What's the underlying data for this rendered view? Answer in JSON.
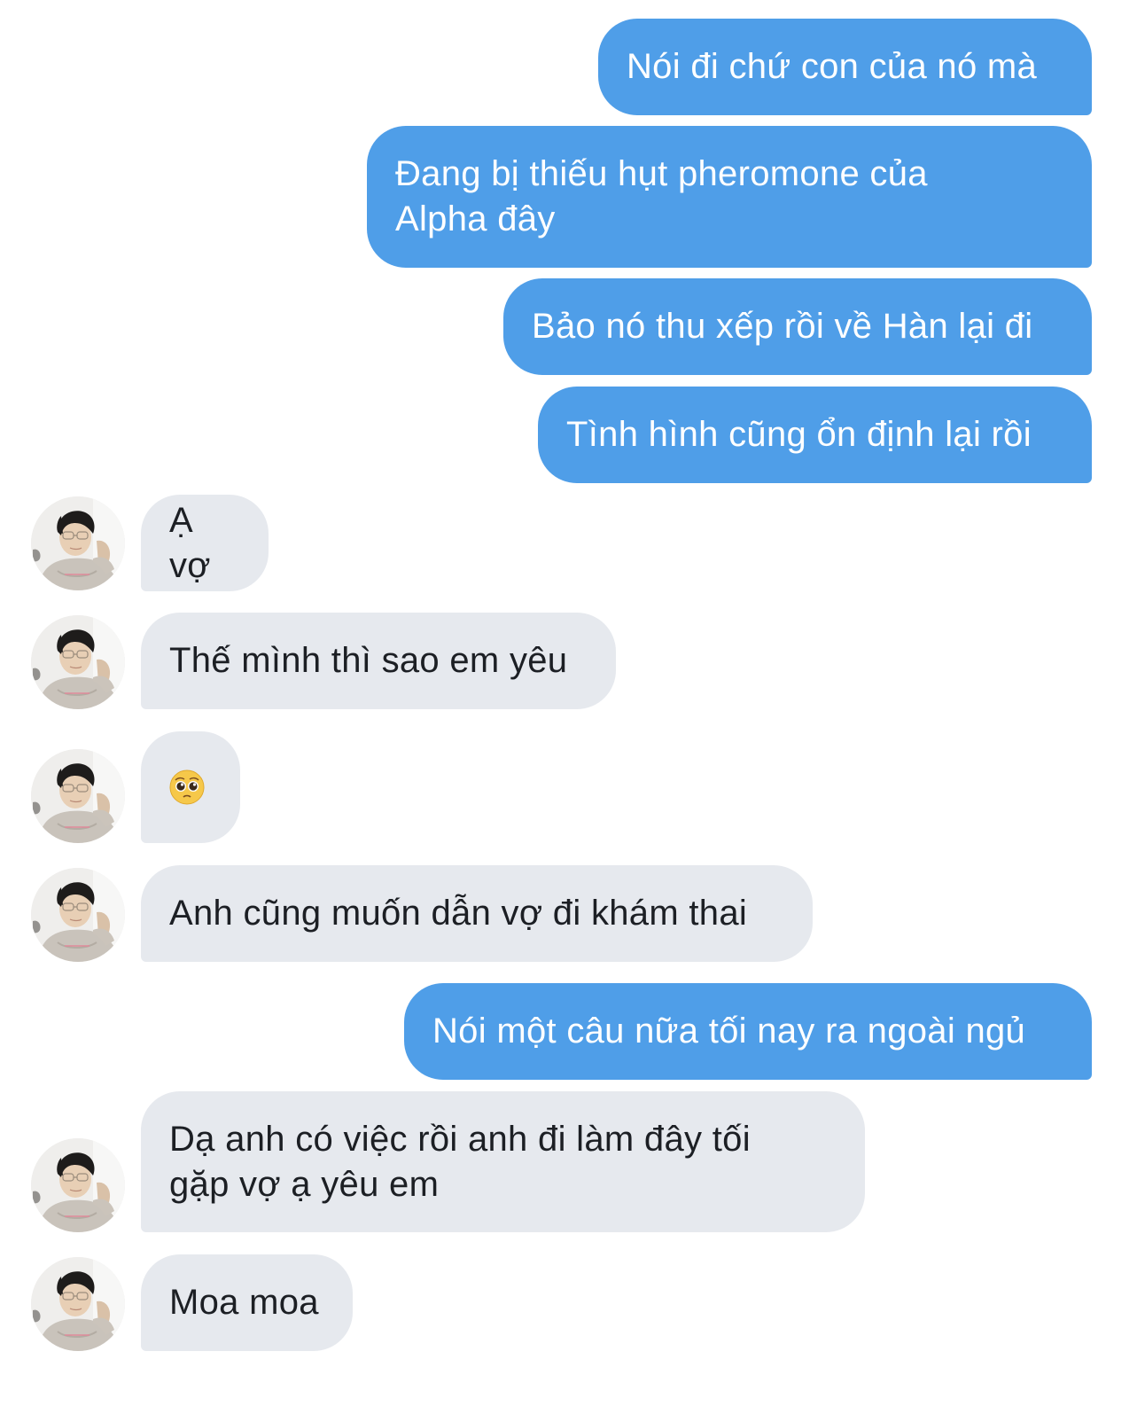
{
  "messages": [
    {
      "id": 1,
      "direction": "outgoing",
      "text": "Nói đi chứ con của nó mà"
    },
    {
      "id": 2,
      "direction": "outgoing",
      "text": "Đang bị thiếu hụt pheromone của Alpha đây"
    },
    {
      "id": 3,
      "direction": "outgoing",
      "text": "Bảo nó thu xếp rồi về Hàn lại đi"
    },
    {
      "id": 4,
      "direction": "outgoing",
      "text": "Tình hình cũng ổn định lại rồi"
    },
    {
      "id": 5,
      "direction": "incoming",
      "text": "Ạ vợ"
    },
    {
      "id": 6,
      "direction": "incoming",
      "text": "Thế mình thì sao em yêu"
    },
    {
      "id": 7,
      "direction": "incoming",
      "text": "",
      "emoji": "pleading-face"
    },
    {
      "id": 8,
      "direction": "incoming",
      "text": "Anh cũng muốn dẫn vợ đi khám thai"
    },
    {
      "id": 9,
      "direction": "outgoing",
      "text": "Nói một câu nữa tối nay ra ngoài ngủ"
    },
    {
      "id": 10,
      "direction": "incoming",
      "text": "Dạ anh có việc rồi anh đi làm đây tối gặp vợ ạ yêu em"
    },
    {
      "id": 11,
      "direction": "incoming",
      "text": "Moa moa"
    }
  ],
  "colors": {
    "outgoing_bubble": "#4f9ee8",
    "outgoing_text": "#ffffff",
    "incoming_bubble": "#e6e9ee",
    "incoming_text": "#1c1f24",
    "background": "#ffffff"
  },
  "avatar": {
    "icon": "user-avatar-photo"
  }
}
